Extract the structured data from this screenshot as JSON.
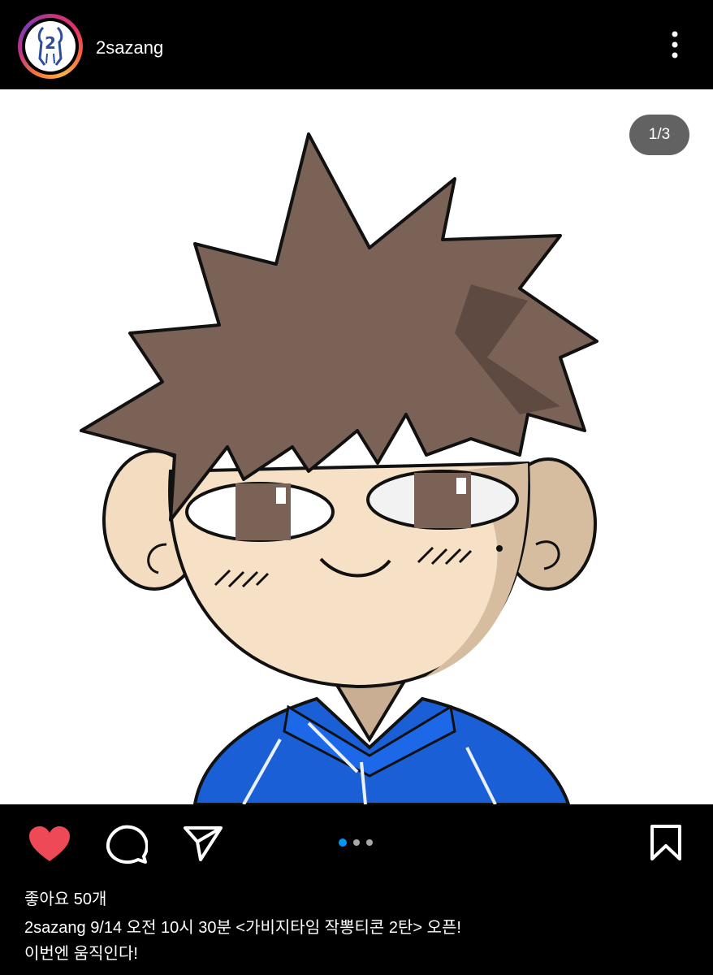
{
  "post": {
    "username": "2sazang",
    "page_indicator": "1/3",
    "likes": "좋아요 50개",
    "caption_author": "2sazang",
    "caption_line1": "9/14 오전 10시 30분 <가비지타임 작뽕티콘 2탄> 오픈!",
    "caption_line2": "이번엔 움직인다!"
  },
  "icons": {
    "like": "heart-icon",
    "comment": "comment-icon",
    "share": "send-icon",
    "save": "bookmark-icon",
    "more": "more-vertical-icon"
  },
  "colors": {
    "background": "#000000",
    "like_red": "#ed4956",
    "dot_active": "#0095f6",
    "dot_inactive": "#a8a8a8",
    "hair": "#7a6256",
    "jacket_blue": "#1a5fd6",
    "skin": "#f7e1c6"
  },
  "carousel": {
    "current": 1,
    "total": 3
  }
}
